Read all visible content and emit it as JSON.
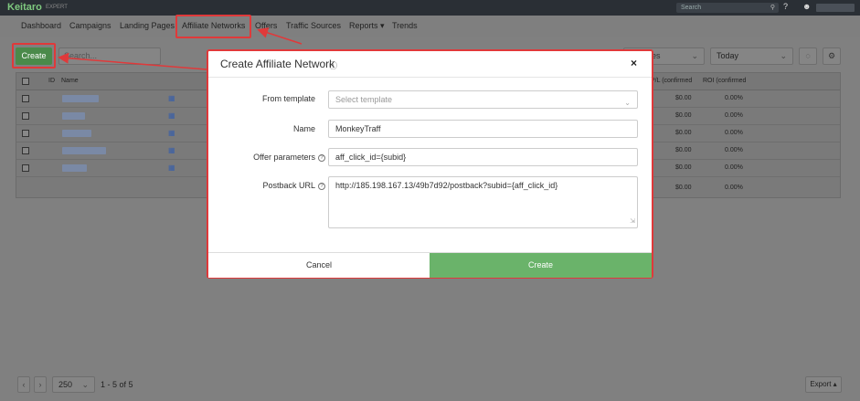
{
  "app": {
    "logo": "Keitaro",
    "logo_sub": "EXPERT"
  },
  "topbar": {
    "search_placeholder": "Search",
    "search_icon": "search-icon",
    "help_glyph": "?",
    "user_glyph": "☻"
  },
  "nav": {
    "items": [
      "Dashboard",
      "Campaigns",
      "Landing Pages",
      "Affiliate Networks",
      "Offers",
      "Traffic Sources",
      "Reports ▾",
      "Trends"
    ]
  },
  "toolbar": {
    "create_label": "Create",
    "search_placeholder": "Search...",
    "columns_label": "es",
    "period_label": "Today"
  },
  "table": {
    "headers": [
      "ID",
      "Name",
      "P/L (confirmed",
      "ROI (confirmed"
    ],
    "rows": [
      {
        "pl": "$0.00",
        "roi": "0.00%"
      },
      {
        "pl": "$0.00",
        "roi": "0.00%"
      },
      {
        "pl": "$0.00",
        "roi": "0.00%"
      },
      {
        "pl": "$0.00",
        "roi": "0.00%"
      },
      {
        "pl": "$0.00",
        "roi": "0.00%"
      }
    ],
    "totals": {
      "pl": "$0.00",
      "roi": "0.00%"
    }
  },
  "pagination": {
    "page_size": "250",
    "info": "1 - 5 of 5",
    "export_label": "Export ▴"
  },
  "modal": {
    "title": "Create Affiliate Network",
    "close": "×",
    "fields": {
      "template": {
        "label": "From template",
        "placeholder": "Select template"
      },
      "name": {
        "label": "Name",
        "value": "MonkeyTraff"
      },
      "offer_params": {
        "label": "Offer parameters",
        "value": "aff_click_id={subid}"
      },
      "postback": {
        "label": "Postback URL",
        "value": "http://185.198.167.13/49b7d92/postback?subid={aff_click_id}"
      }
    },
    "cancel_label": "Cancel",
    "create_label": "Create"
  },
  "colors": {
    "accent": "#6ab36a",
    "annotation": "#e0393a",
    "topbar": "#2a2f35"
  }
}
